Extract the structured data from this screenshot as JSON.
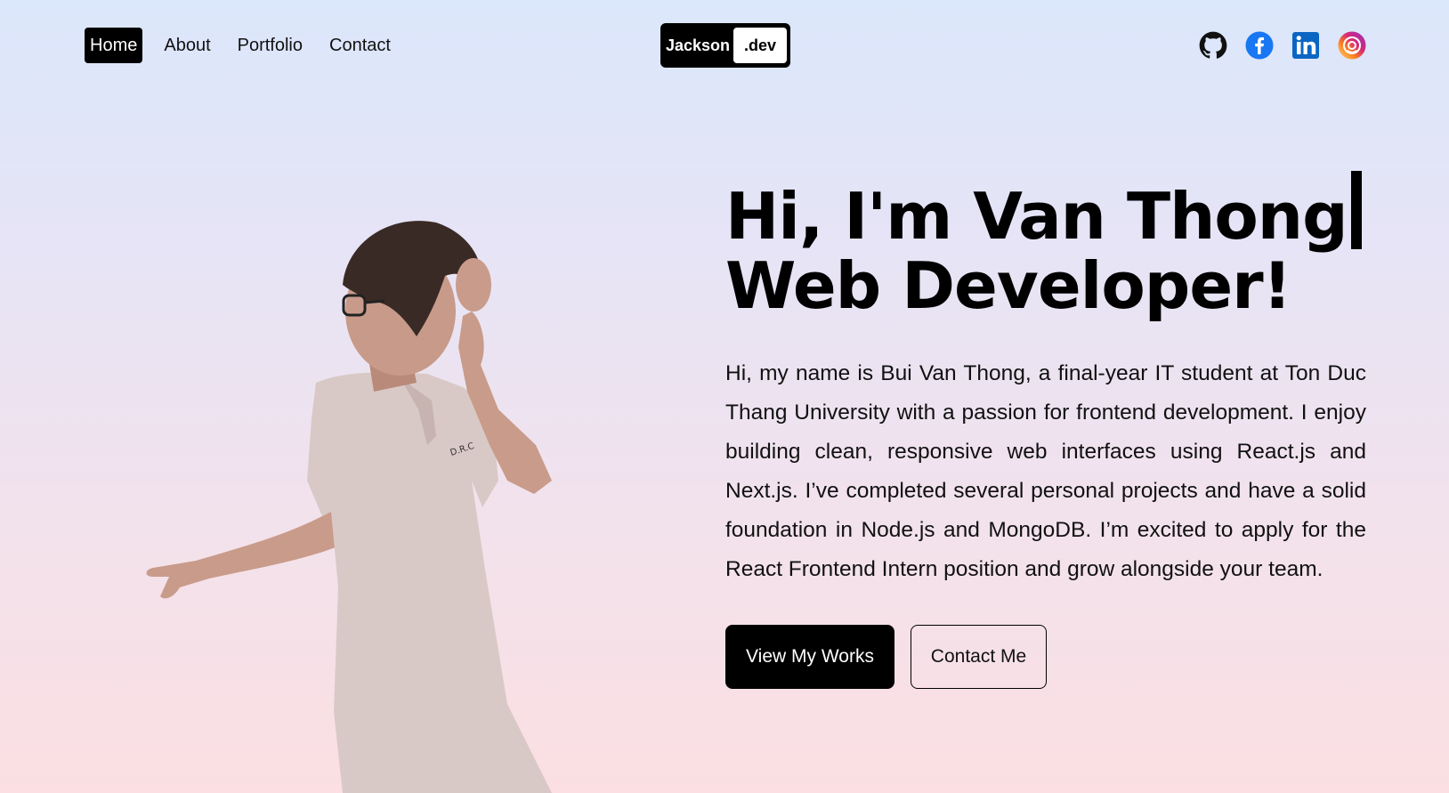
{
  "nav": {
    "links": [
      "Home",
      "About",
      "Portfolio",
      "Contact"
    ],
    "active": "Home"
  },
  "logo": {
    "left": "Jackson",
    "right": ".dev"
  },
  "socials": [
    "github-icon",
    "facebook-icon",
    "linkedin-icon",
    "instagram-icon"
  ],
  "hero": {
    "line1": "Hi, I'm Van Thong",
    "line2": "Web Developer!",
    "bio": "Hi, my name is Bui Van Thong, a final-year IT student at Ton Duc Thang University with a passion for frontend development. I enjoy building clean, responsive web interfaces using React.js and Next.js. I’ve completed several personal projects and have a solid foundation in Node.js and MongoDB. I’m excited to apply for the React Frontend Intern position and grow alongside your team.",
    "primary_button": "View My Works",
    "secondary_button": "Contact Me"
  },
  "colors": {
    "accent": "#000000",
    "facebook": "#1877f2",
    "linkedin": "#0a66c2",
    "instagram": "#d62976"
  }
}
